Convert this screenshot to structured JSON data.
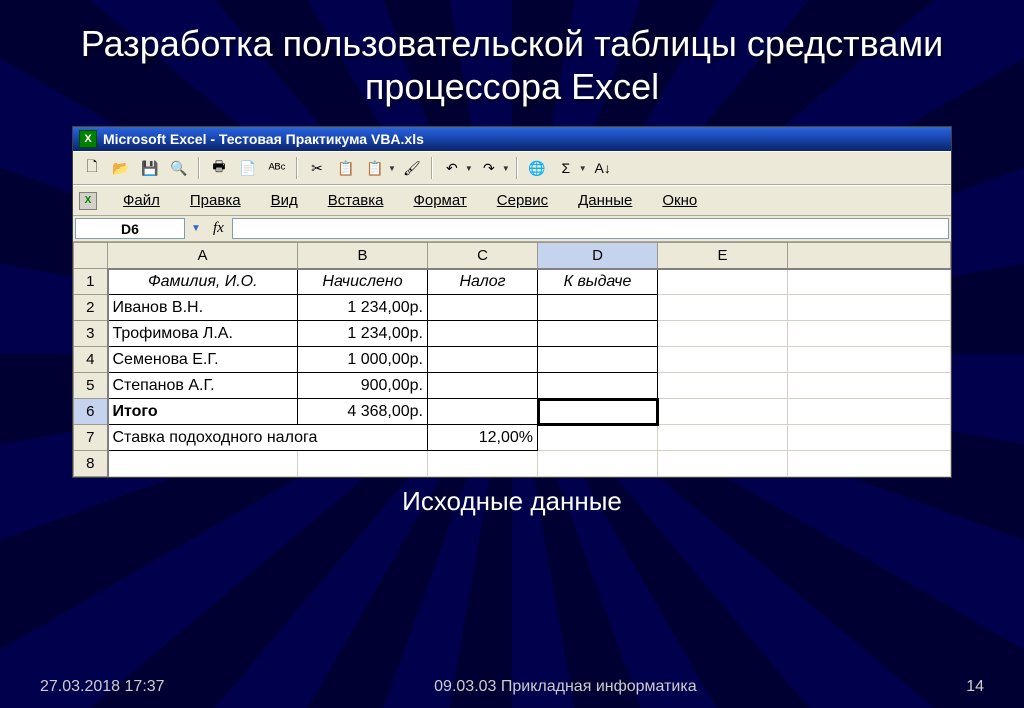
{
  "slide": {
    "title": "Разработка пользовательской таблицы средствами процессора Excel",
    "caption": "Исходные данные",
    "footer_left": "27.03.2018 17:37",
    "footer_center": "09.03.03 Прикладная информатика",
    "footer_right": "14"
  },
  "excel": {
    "titlebar": "Microsoft Excel - Тестовая Практикума VBA.xls",
    "menu": [
      "Файл",
      "Правка",
      "Вид",
      "Вставка",
      "Формат",
      "Сервис",
      "Данные",
      "Окно"
    ],
    "namebox": "D6",
    "fx_label": "fx",
    "columns": [
      "A",
      "B",
      "C",
      "D",
      "E"
    ],
    "headers": {
      "A": "Фамилия, И.О.",
      "B": "Начислено",
      "C": "Налог",
      "D": "К выдаче"
    },
    "rows": [
      {
        "n": "1"
      },
      {
        "n": "2",
        "A": "Иванов В.Н.",
        "B": "1 234,00р."
      },
      {
        "n": "3",
        "A": "Трофимова Л.А.",
        "B": "1 234,00р."
      },
      {
        "n": "4",
        "A": "Семенова Е.Г.",
        "B": "1 000,00р."
      },
      {
        "n": "5",
        "A": "Степанов А.Г.",
        "B": "900,00р."
      },
      {
        "n": "6",
        "A": "Итого",
        "B": "4 368,00р."
      },
      {
        "n": "7",
        "A": "Ставка подоходного налога",
        "C": "12,00%"
      },
      {
        "n": "8"
      }
    ]
  },
  "icons": {
    "new": "🗋",
    "open": "📂",
    "save": "💾",
    "search": "🔍",
    "print": "🖶",
    "preview": "📄",
    "spell": "ᴬᴮᶜ",
    "cut": "✂",
    "copy": "📋",
    "paste": "📋",
    "brush": "🖌",
    "undo": "↶",
    "redo": "↷",
    "globe": "🌐",
    "sum": "Σ",
    "sort": "A↓"
  }
}
